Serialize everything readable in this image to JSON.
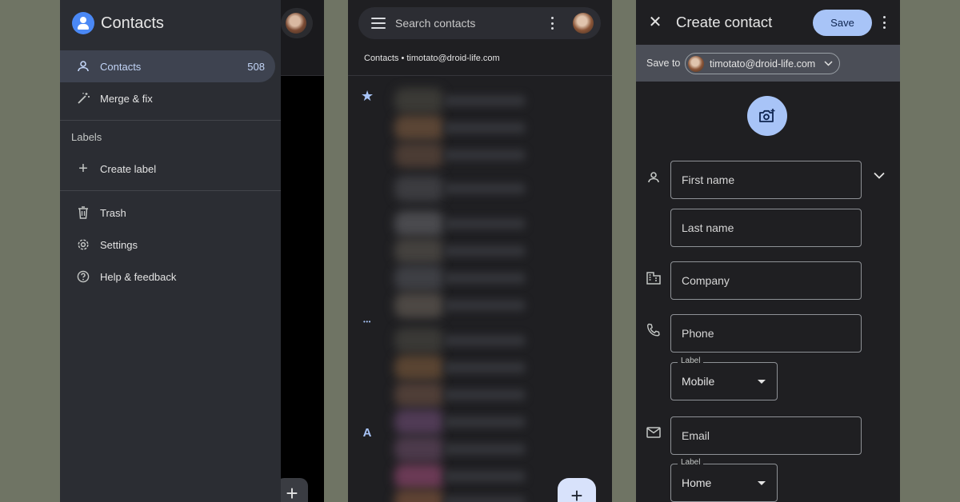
{
  "drawer": {
    "app_title": "Contacts",
    "items": [
      {
        "label": "Contacts",
        "count": "508"
      },
      {
        "label": "Merge & fix"
      }
    ],
    "labels_heading": "Labels",
    "create_label": "Create label",
    "bottom_items": [
      {
        "label": "Trash"
      },
      {
        "label": "Settings"
      },
      {
        "label": "Help & feedback"
      }
    ]
  },
  "list": {
    "search_placeholder": "Search contacts",
    "account_line": "Contacts • timotato@droid-life.com",
    "rail": {
      "starred": "★",
      "more": "•••",
      "letter": "A"
    },
    "fab": "+"
  },
  "create": {
    "title": "Create contact",
    "save": "Save",
    "save_to_label": "Save to",
    "account": "timotato@droid-life.com",
    "fields": {
      "first_name": "First name",
      "last_name": "Last name",
      "company": "Company",
      "phone": "Phone",
      "phone_label_legend": "Label",
      "phone_label_value": "Mobile",
      "email": "Email",
      "email_label_legend": "Label",
      "email_label_value": "Home"
    }
  },
  "colors": {
    "accent": "#a8c4f7",
    "drawer_bg": "#2b2d33",
    "page_bg": "#1f1f22",
    "outer_bg": "#6f7464"
  }
}
